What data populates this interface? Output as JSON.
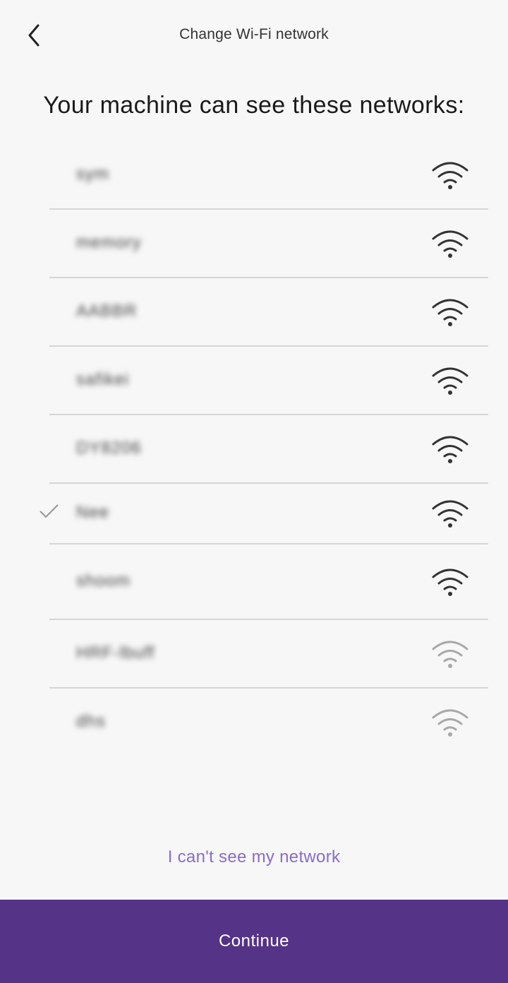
{
  "header": {
    "title": "Change Wi-Fi network",
    "back_icon": "chevron-left-icon"
  },
  "heading": "Your machine can see these networks:",
  "networks": [
    {
      "name": "sym",
      "signal": "strong",
      "selected": false
    },
    {
      "name": "memory",
      "signal": "strong",
      "selected": false
    },
    {
      "name": "AABBR",
      "signal": "strong",
      "selected": false
    },
    {
      "name": "safikei",
      "signal": "strong",
      "selected": false
    },
    {
      "name": "DY8206",
      "signal": "strong",
      "selected": false
    },
    {
      "name": "Nee",
      "signal": "strong",
      "selected": true
    },
    {
      "name": "shoom",
      "signal": "strong",
      "selected": false
    },
    {
      "name": "HRF-lbuff",
      "signal": "weak",
      "selected": false
    },
    {
      "name": "dhs",
      "signal": "weak",
      "selected": false
    }
  ],
  "colors": {
    "accent": "#553386",
    "link": "#8a6cc8",
    "wifi_strong": "#333333",
    "wifi_weak": "#a8a8a8"
  },
  "link_text": "I can't see my network",
  "continue_label": "Continue"
}
